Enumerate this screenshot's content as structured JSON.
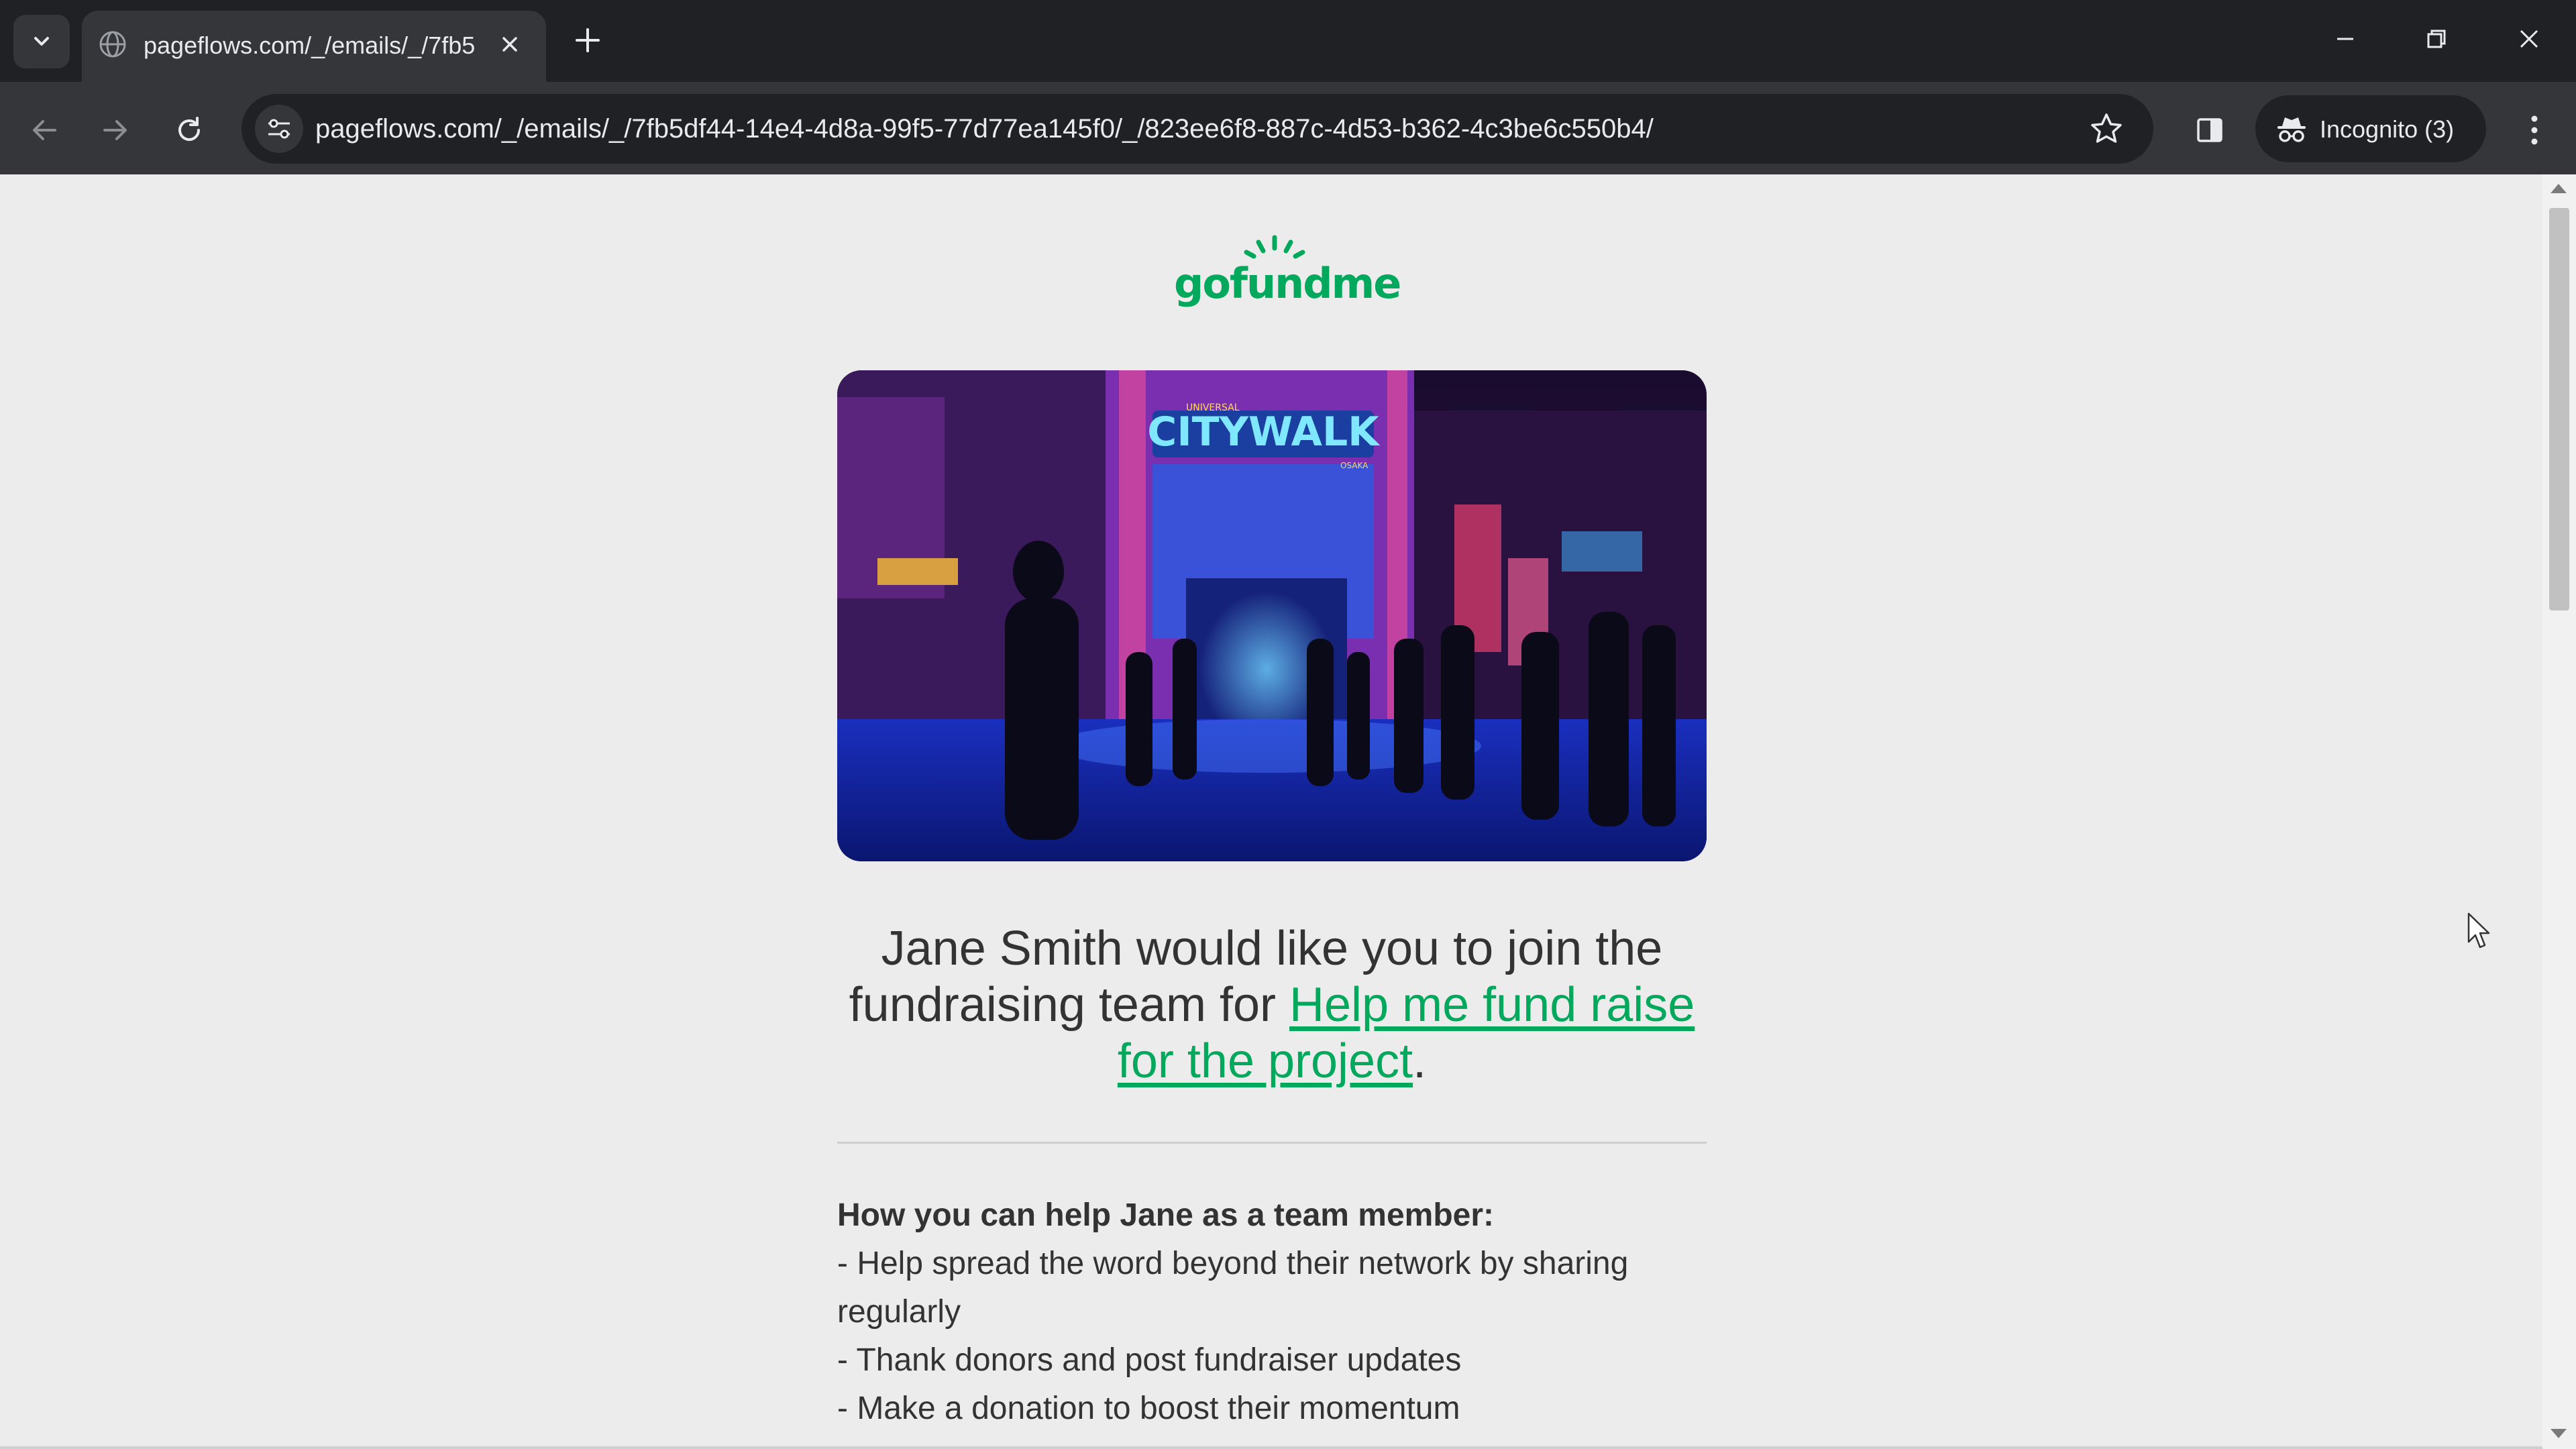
{
  "browser": {
    "tab": {
      "title": "pageflows.com/_/emails/_/7fb5"
    },
    "address_bar": {
      "url": "pageflows.com/_/emails/_/7fb5df44-14e4-4d8a-99f5-77d77ea145f0/_/823ee6f8-887c-4d53-b362-4c3be6c550b4/"
    },
    "profile": {
      "label": "Incognito (3)"
    }
  },
  "email": {
    "logo_text": "gofundme",
    "hero_image": {
      "sign_text": "CITYWALK",
      "sign_small_top": "UNIVERSAL",
      "sign_small_side": "OSAKA"
    },
    "headline": {
      "text_before": "Jane Smith would like you to join the fundraising team for ",
      "link_text": "Help me fund raise for the project",
      "text_after": "."
    },
    "help": {
      "heading": "How you can help Jane as a team member:",
      "items": [
        "- Help spread the word beyond their network by sharing regularly",
        "- Thank donors and post fundraiser updates",
        "- Make a donation to boost their momentum"
      ]
    }
  },
  "colors": {
    "brand_green": "#02a95c",
    "chrome_dark": "#202124",
    "chrome_mid": "#35363a",
    "page_bg": "#ececec",
    "text": "#333333"
  }
}
